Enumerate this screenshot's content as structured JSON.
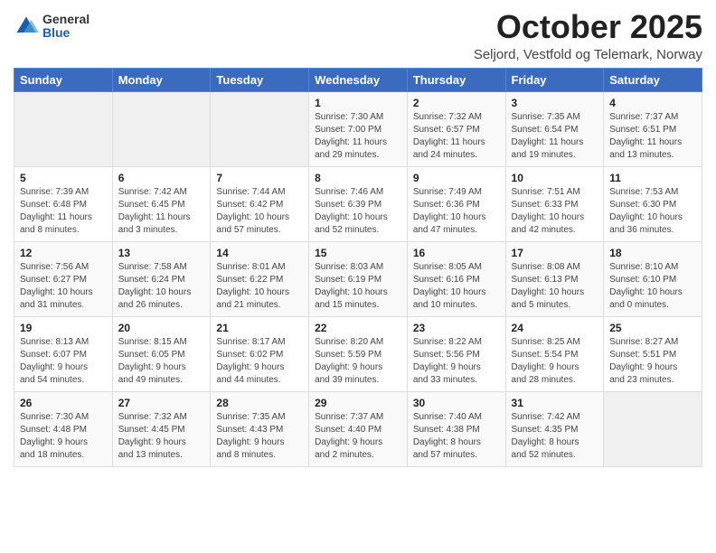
{
  "header": {
    "logo_general": "General",
    "logo_blue": "Blue",
    "month_title": "October 2025",
    "subtitle": "Seljord, Vestfold og Telemark, Norway"
  },
  "weekdays": [
    "Sunday",
    "Monday",
    "Tuesday",
    "Wednesday",
    "Thursday",
    "Friday",
    "Saturday"
  ],
  "weeks": [
    [
      {
        "day": "",
        "info": ""
      },
      {
        "day": "",
        "info": ""
      },
      {
        "day": "",
        "info": ""
      },
      {
        "day": "1",
        "info": "Sunrise: 7:30 AM\nSunset: 7:00 PM\nDaylight: 11 hours\nand 29 minutes."
      },
      {
        "day": "2",
        "info": "Sunrise: 7:32 AM\nSunset: 6:57 PM\nDaylight: 11 hours\nand 24 minutes."
      },
      {
        "day": "3",
        "info": "Sunrise: 7:35 AM\nSunset: 6:54 PM\nDaylight: 11 hours\nand 19 minutes."
      },
      {
        "day": "4",
        "info": "Sunrise: 7:37 AM\nSunset: 6:51 PM\nDaylight: 11 hours\nand 13 minutes."
      }
    ],
    [
      {
        "day": "5",
        "info": "Sunrise: 7:39 AM\nSunset: 6:48 PM\nDaylight: 11 hours\nand 8 minutes."
      },
      {
        "day": "6",
        "info": "Sunrise: 7:42 AM\nSunset: 6:45 PM\nDaylight: 11 hours\nand 3 minutes."
      },
      {
        "day": "7",
        "info": "Sunrise: 7:44 AM\nSunset: 6:42 PM\nDaylight: 10 hours\nand 57 minutes."
      },
      {
        "day": "8",
        "info": "Sunrise: 7:46 AM\nSunset: 6:39 PM\nDaylight: 10 hours\nand 52 minutes."
      },
      {
        "day": "9",
        "info": "Sunrise: 7:49 AM\nSunset: 6:36 PM\nDaylight: 10 hours\nand 47 minutes."
      },
      {
        "day": "10",
        "info": "Sunrise: 7:51 AM\nSunset: 6:33 PM\nDaylight: 10 hours\nand 42 minutes."
      },
      {
        "day": "11",
        "info": "Sunrise: 7:53 AM\nSunset: 6:30 PM\nDaylight: 10 hours\nand 36 minutes."
      }
    ],
    [
      {
        "day": "12",
        "info": "Sunrise: 7:56 AM\nSunset: 6:27 PM\nDaylight: 10 hours\nand 31 minutes."
      },
      {
        "day": "13",
        "info": "Sunrise: 7:58 AM\nSunset: 6:24 PM\nDaylight: 10 hours\nand 26 minutes."
      },
      {
        "day": "14",
        "info": "Sunrise: 8:01 AM\nSunset: 6:22 PM\nDaylight: 10 hours\nand 21 minutes."
      },
      {
        "day": "15",
        "info": "Sunrise: 8:03 AM\nSunset: 6:19 PM\nDaylight: 10 hours\nand 15 minutes."
      },
      {
        "day": "16",
        "info": "Sunrise: 8:05 AM\nSunset: 6:16 PM\nDaylight: 10 hours\nand 10 minutes."
      },
      {
        "day": "17",
        "info": "Sunrise: 8:08 AM\nSunset: 6:13 PM\nDaylight: 10 hours\nand 5 minutes."
      },
      {
        "day": "18",
        "info": "Sunrise: 8:10 AM\nSunset: 6:10 PM\nDaylight: 10 hours\nand 0 minutes."
      }
    ],
    [
      {
        "day": "19",
        "info": "Sunrise: 8:13 AM\nSunset: 6:07 PM\nDaylight: 9 hours\nand 54 minutes."
      },
      {
        "day": "20",
        "info": "Sunrise: 8:15 AM\nSunset: 6:05 PM\nDaylight: 9 hours\nand 49 minutes."
      },
      {
        "day": "21",
        "info": "Sunrise: 8:17 AM\nSunset: 6:02 PM\nDaylight: 9 hours\nand 44 minutes."
      },
      {
        "day": "22",
        "info": "Sunrise: 8:20 AM\nSunset: 5:59 PM\nDaylight: 9 hours\nand 39 minutes."
      },
      {
        "day": "23",
        "info": "Sunrise: 8:22 AM\nSunset: 5:56 PM\nDaylight: 9 hours\nand 33 minutes."
      },
      {
        "day": "24",
        "info": "Sunrise: 8:25 AM\nSunset: 5:54 PM\nDaylight: 9 hours\nand 28 minutes."
      },
      {
        "day": "25",
        "info": "Sunrise: 8:27 AM\nSunset: 5:51 PM\nDaylight: 9 hours\nand 23 minutes."
      }
    ],
    [
      {
        "day": "26",
        "info": "Sunrise: 7:30 AM\nSunset: 4:48 PM\nDaylight: 9 hours\nand 18 minutes."
      },
      {
        "day": "27",
        "info": "Sunrise: 7:32 AM\nSunset: 4:45 PM\nDaylight: 9 hours\nand 13 minutes."
      },
      {
        "day": "28",
        "info": "Sunrise: 7:35 AM\nSunset: 4:43 PM\nDaylight: 9 hours\nand 8 minutes."
      },
      {
        "day": "29",
        "info": "Sunrise: 7:37 AM\nSunset: 4:40 PM\nDaylight: 9 hours\nand 2 minutes."
      },
      {
        "day": "30",
        "info": "Sunrise: 7:40 AM\nSunset: 4:38 PM\nDaylight: 8 hours\nand 57 minutes."
      },
      {
        "day": "31",
        "info": "Sunrise: 7:42 AM\nSunset: 4:35 PM\nDaylight: 8 hours\nand 52 minutes."
      },
      {
        "day": "",
        "info": ""
      }
    ]
  ]
}
